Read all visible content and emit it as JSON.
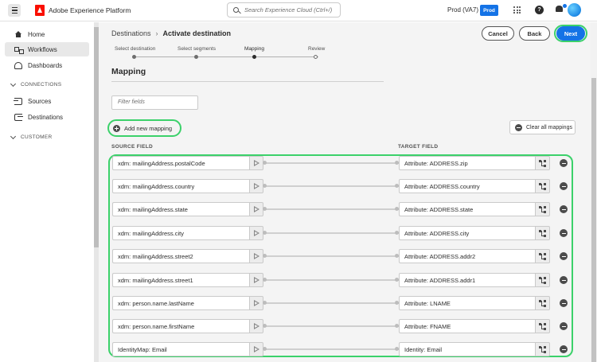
{
  "topbar": {
    "app_title": "Adobe Experience Platform",
    "search_placeholder": "Search Experience Cloud (Ctrl+/)",
    "org": "Prod (VA7)",
    "sandbox_badge": "Prod",
    "accent_color": "#1473e6"
  },
  "sidebar": {
    "items": [
      {
        "label": "Home",
        "icon": "home-icon"
      },
      {
        "label": "Workflows",
        "icon": "workflows-icon"
      },
      {
        "label": "Dashboards",
        "icon": "dashboards-icon"
      }
    ],
    "connections_header": "CONNECTIONS",
    "connections": [
      {
        "label": "Sources",
        "icon": "sources-icon"
      },
      {
        "label": "Destinations",
        "icon": "destinations-icon"
      }
    ],
    "customer_header": "CUSTOMER"
  },
  "breadcrumb": {
    "parent": "Destinations",
    "current": "Activate destination"
  },
  "actions": {
    "cancel": "Cancel",
    "back": "Back",
    "next": "Next"
  },
  "steps": [
    {
      "label": "Select destination",
      "state": "done"
    },
    {
      "label": "Select segments",
      "state": "done"
    },
    {
      "label": "Mapping",
      "state": "current"
    },
    {
      "label": "Review",
      "state": "upcoming"
    }
  ],
  "mapping": {
    "title": "Mapping",
    "filter_placeholder": "Filter fields",
    "add_label": "Add new mapping",
    "clear_label": "Clear all mappings",
    "source_header": "SOURCE FIELD",
    "target_header": "TARGET FIELD",
    "highlight_color": "#3bd16a",
    "rows": [
      {
        "source": "xdm: mailingAddress.postalCode",
        "target": "Attribute: ADDRESS.zip"
      },
      {
        "source": "xdm: mailingAddress.country",
        "target": "Attribute: ADDRESS.country"
      },
      {
        "source": "xdm: mailingAddress.state",
        "target": "Attribute: ADDRESS.state"
      },
      {
        "source": "xdm: mailingAddress.city",
        "target": "Attribute: ADDRESS.city"
      },
      {
        "source": "xdm: mailingAddress.street2",
        "target": "Attribute: ADDRESS.addr2"
      },
      {
        "source": "xdm: mailingAddress.street1",
        "target": "Attribute: ADDRESS.addr1"
      },
      {
        "source": "xdm: person.name.lastName",
        "target": "Attribute: LNAME"
      },
      {
        "source": "xdm: person.name.firstName",
        "target": "Attribute: FNAME"
      },
      {
        "source": "IdentityMap: Email",
        "target": "Identity: Email"
      }
    ]
  }
}
